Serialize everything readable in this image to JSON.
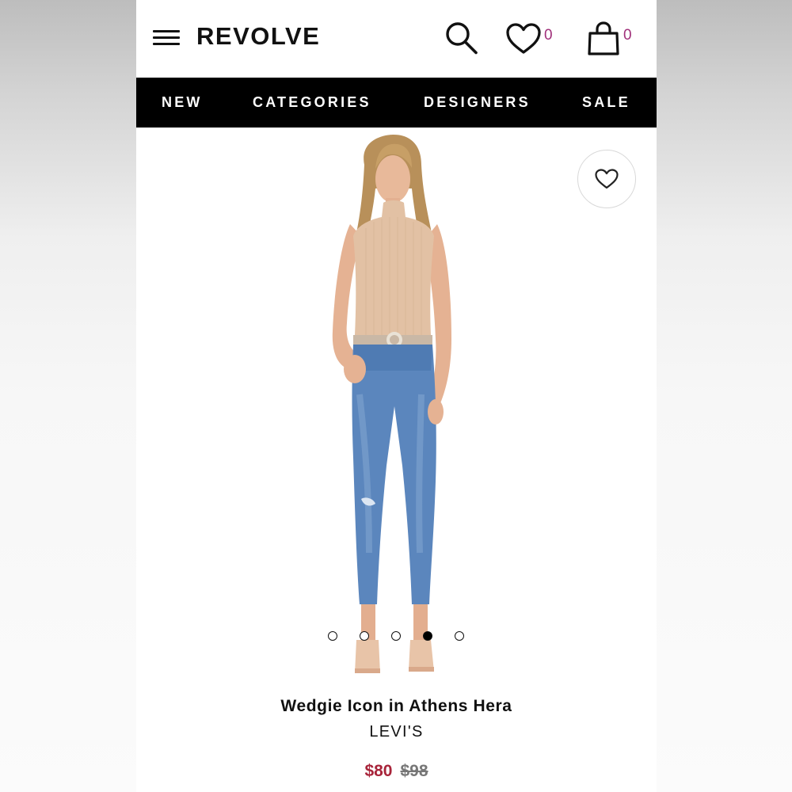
{
  "header": {
    "logo": "REVOLVE",
    "wishlist_count": "0",
    "bag_count": "0"
  },
  "nav": {
    "items": [
      "NEW",
      "CATEGORIES",
      "DESIGNERS",
      "SALE"
    ]
  },
  "product": {
    "name": "Wedgie Icon in Athens Hera",
    "brand": "LEVI'S",
    "sale_price": "$80",
    "original_price": "$98",
    "image_carousel": {
      "total_images": 5,
      "active_index": 4
    }
  },
  "icons": {
    "menu": "menu-icon",
    "search": "search-icon",
    "wishlist": "heart-icon",
    "bag": "bag-icon",
    "add_to_wishlist": "heart-outline-icon"
  },
  "colors": {
    "nav_bg": "#000000",
    "count_accent": "#a0307a",
    "sale_price": "#a8243a",
    "original_price": "#777777"
  }
}
